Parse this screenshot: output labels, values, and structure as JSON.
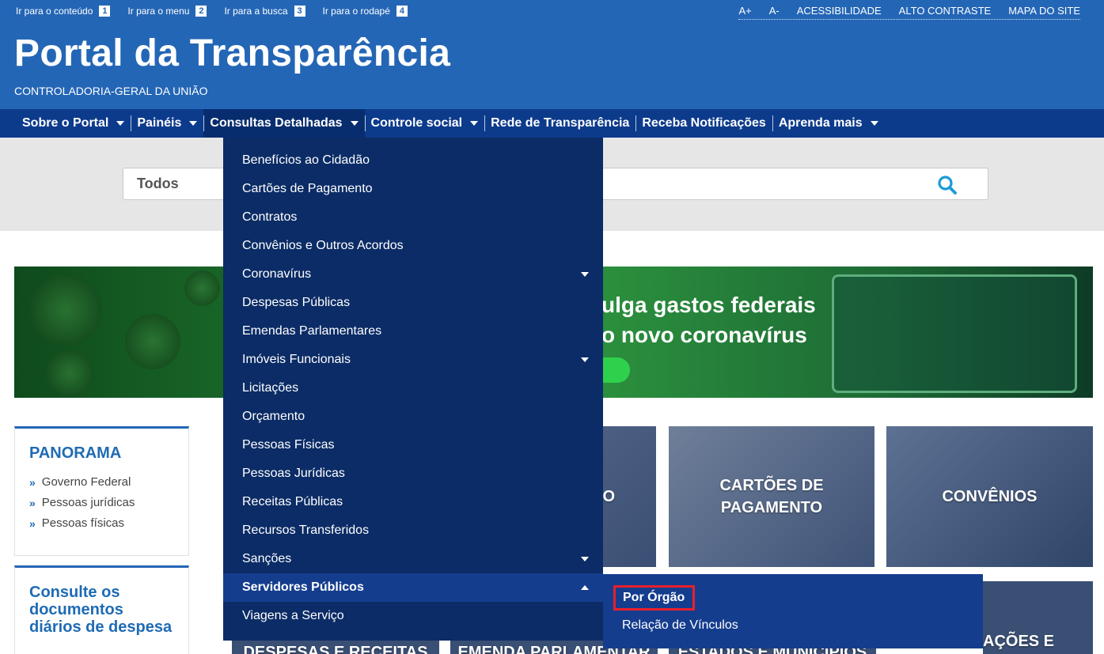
{
  "skip_links": [
    {
      "label": "Ir para o conteúdo",
      "num": "1"
    },
    {
      "label": "Ir para o menu",
      "num": "2"
    },
    {
      "label": "Ir para a busca",
      "num": "3"
    },
    {
      "label": "Ir para o rodapé",
      "num": "4"
    }
  ],
  "utility": {
    "font_up": "A+",
    "font_down": "A-",
    "accessibility": "ACESSIBILIDADE",
    "contrast": "ALTO CONTRASTE",
    "sitemap": "MAPA DO SITE"
  },
  "header": {
    "title": "Portal da Transparência",
    "subtitle": "CONTROLADORIA-GERAL DA UNIÃO"
  },
  "nav": [
    {
      "label": "Sobre o Portal"
    },
    {
      "label": "Painéis"
    },
    {
      "label": "Consultas Detalhadas"
    },
    {
      "label": "Controle social"
    },
    {
      "label": "Rede de Transparência"
    },
    {
      "label": "Receba Notificações"
    },
    {
      "label": "Aprenda mais"
    }
  ],
  "search": {
    "scope": "Todos",
    "icon": "search-icon"
  },
  "banner": {
    "line1": "ulga gastos federais",
    "line2": "o novo coronavírus"
  },
  "dropdown": [
    {
      "label": "Benefícios ao Cidadão"
    },
    {
      "label": "Cartões de Pagamento"
    },
    {
      "label": "Contratos"
    },
    {
      "label": "Convênios e Outros Acordos"
    },
    {
      "label": "Coronavírus"
    },
    {
      "label": "Despesas Públicas"
    },
    {
      "label": "Emendas Parlamentares"
    },
    {
      "label": "Imóveis Funcionais"
    },
    {
      "label": "Licitações"
    },
    {
      "label": "Orçamento"
    },
    {
      "label": "Pessoas Físicas"
    },
    {
      "label": "Pessoas Jurídicas"
    },
    {
      "label": "Receitas Públicas"
    },
    {
      "label": "Recursos Transferidos"
    },
    {
      "label": "Sanções"
    },
    {
      "label": "Servidores Públicos"
    },
    {
      "label": "Viagens a Serviço"
    }
  ],
  "submenu": {
    "item1": "Por Órgão",
    "item2": "Relação de Vínculos"
  },
  "panorama": {
    "title": "PANORAMA",
    "items": [
      "Governo Federal",
      "Pessoas jurídicas",
      "Pessoas físicas"
    ]
  },
  "consulte": {
    "title": "Consulte os documentos diários de despesa"
  },
  "tiles": {
    "t1": "O",
    "t2_line1": "CARTÕES DE",
    "t2_line2": "PAGAMENTO",
    "t3": "CONVÊNIOS",
    "b1": "DESPESAS E RECEITAS",
    "b2": "EMENDA PARLAMENTAR",
    "b3": "ESTADOS E MUNICÍPIOS",
    "b4": "AÇÕES E"
  },
  "colors": {
    "header_blue": "#2466b6",
    "nav_blue": "#0d3b8c",
    "dropdown_blue": "#0b2c66",
    "highlight_red": "#e8202a"
  }
}
